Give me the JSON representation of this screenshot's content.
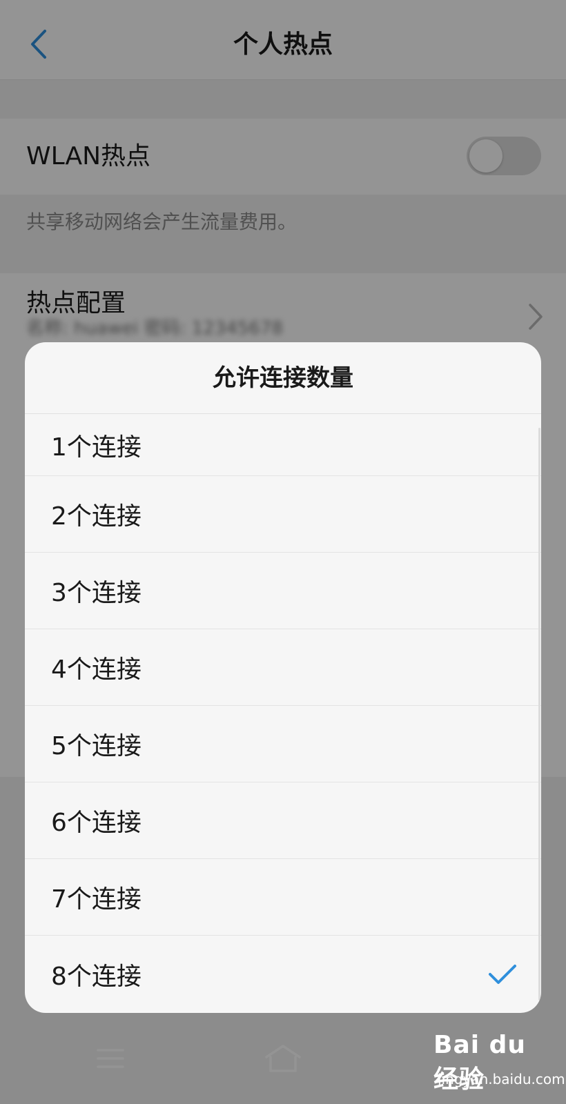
{
  "header": {
    "title": "个人热点"
  },
  "wlan": {
    "label": "WLAN热点",
    "enabled": false
  },
  "note": "共享移动网络会产生流量费用。",
  "config": {
    "title": "热点配置",
    "subtitle": "名称: huawei 密码: 12345678"
  },
  "dialog": {
    "title": "允许连接数量",
    "options": [
      {
        "label": "1个连接",
        "selected": false
      },
      {
        "label": "2个连接",
        "selected": false
      },
      {
        "label": "3个连接",
        "selected": false
      },
      {
        "label": "4个连接",
        "selected": false
      },
      {
        "label": "5个连接",
        "selected": false
      },
      {
        "label": "6个连接",
        "selected": false
      },
      {
        "label": "7个连接",
        "selected": false
      },
      {
        "label": "8个连接",
        "selected": true
      }
    ]
  },
  "watermark": {
    "logo": "Bai du 经验",
    "text": "jingyan.baidu.com"
  },
  "icons": {
    "back": "chevron-left-icon",
    "chevron": "chevron-right-icon",
    "check": "check-icon",
    "menu": "menu-icon",
    "home": "home-icon"
  },
  "colors": {
    "accent": "#2f8fdc",
    "toggle_off": "#dcdcdc"
  }
}
